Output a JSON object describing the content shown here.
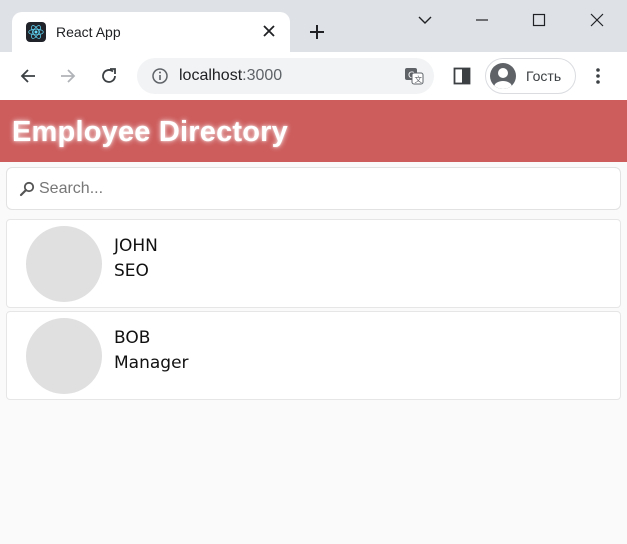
{
  "browser": {
    "tab": {
      "title": "React App",
      "favicon": "react-logo-icon"
    },
    "address": {
      "host": "localhost",
      "port": ":3000"
    },
    "profile_label": "Гость"
  },
  "app": {
    "title": "Employee Directory",
    "header_color": "#cd5c5c",
    "search": {
      "placeholder": "Search...",
      "value": ""
    },
    "employees": [
      {
        "name": "JOHN",
        "role": "SEO"
      },
      {
        "name": "BOB",
        "role": "Manager"
      }
    ]
  }
}
